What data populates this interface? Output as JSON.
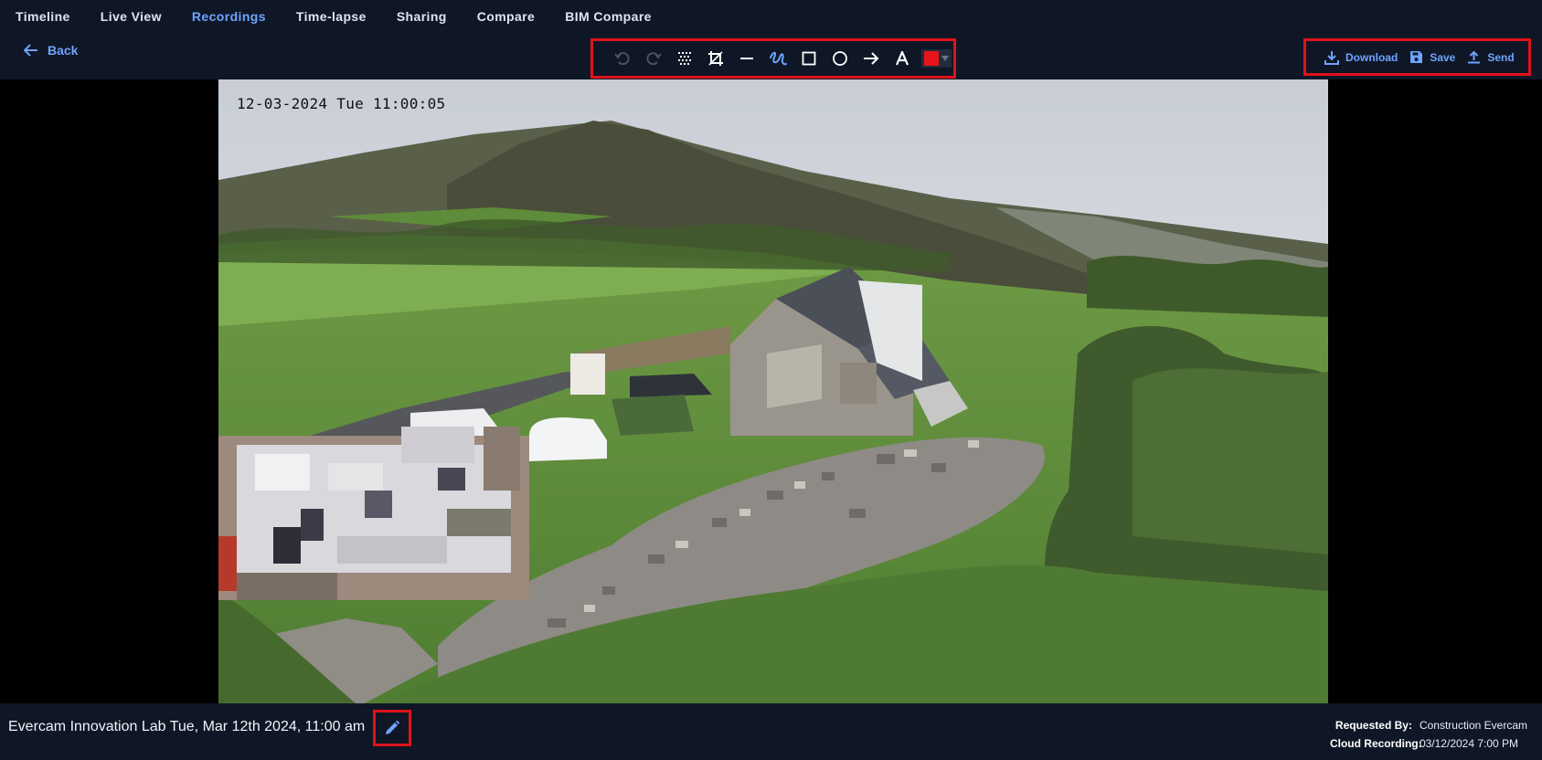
{
  "nav": {
    "tabs": [
      {
        "label": "Timeline"
      },
      {
        "label": "Live View"
      },
      {
        "label": "Recordings",
        "active": true
      },
      {
        "label": "Time-lapse"
      },
      {
        "label": "Sharing"
      },
      {
        "label": "Compare"
      },
      {
        "label": "BIM Compare"
      }
    ]
  },
  "toolbar": {
    "back_label": "Back",
    "tools": [
      "undo-icon",
      "redo-icon",
      "blur-icon",
      "crop-icon",
      "line-icon",
      "freehand-icon",
      "rectangle-icon",
      "circle-icon",
      "arrow-icon",
      "text-icon"
    ],
    "selected_color": "#e8141b",
    "actions": {
      "download_label": "Download",
      "save_label": "Save",
      "send_label": "Send"
    }
  },
  "viewer": {
    "timestamp_overlay": "12-03-2024 Tue 11:00:05"
  },
  "footer": {
    "title": "Evercam Innovation Lab Tue, Mar 12th 2024, 11:00 am",
    "requested_by_label": "Requested By:",
    "requested_by_value": "Construction Evercam",
    "cloud_recording_label": "Cloud Recording:",
    "cloud_recording_value": "03/12/2024 7:00 PM"
  },
  "colors": {
    "accent": "#6ea3ff",
    "background": "#0f1726",
    "highlight": "#e0121b"
  }
}
